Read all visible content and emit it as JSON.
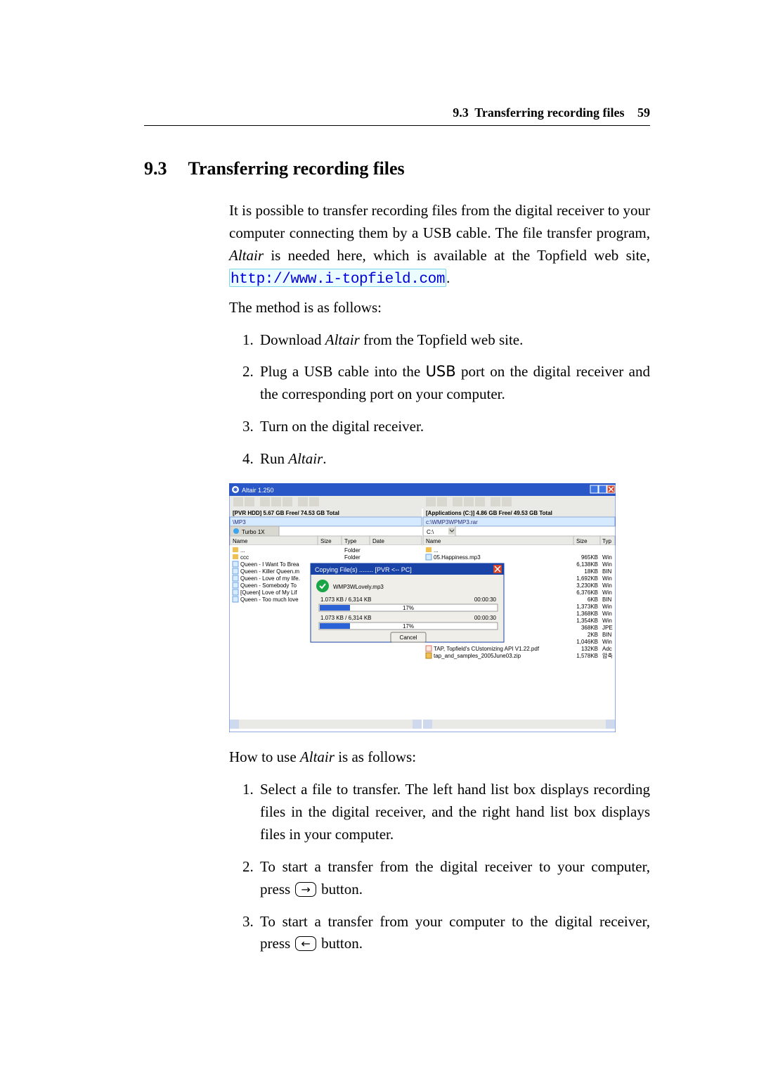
{
  "running_head": {
    "section_num": "9.3",
    "section_title": "Transferring recording files",
    "page_num": "59"
  },
  "heading": {
    "number": "9.3",
    "title": "Transferring recording files"
  },
  "para1_a": "It is possible to transfer recording files from the digital receiver to your computer connecting them by a USB cable. The file transfer program, ",
  "para1_b": " is needed here, which is available at the Topfield web site, ",
  "altair": "Altair",
  "url": "http://www.i-topfield.com",
  "para1_c": ".",
  "method_intro": "The method is as follows:",
  "steps_a": {
    "s1a": "Download ",
    "s1b": " from the Topfield web site.",
    "s2a": "Plug a USB cable into the ",
    "usb": "USB",
    "s2b": " port on the digital receiver and the corresponding port on your computer.",
    "s3": "Turn on the digital receiver.",
    "s4a": "Run ",
    "s4b": "."
  },
  "screenshot": {
    "title": "Altair  1.250",
    "left_stat": "[PVR HDD] 5.67 GB Free/ 74.53 GB Total",
    "right_stat": "[Applications (C:)] 4.86 GB Free/ 49.53 GB Total",
    "left_path": "\\MP3",
    "right_path": "c:\\WMP3WPMP3.rar",
    "turbo_btn": "Turbo  1X",
    "drive_sel": "C:\\",
    "hdr_name": "Name",
    "hdr_size": "Size",
    "hdr_type": "Type",
    "hdr_date": "Date",
    "hdr_typ2": "Typ",
    "left_rows": [
      {
        "name": "...",
        "type": "Folder"
      },
      {
        "name": "ccc",
        "type": "Folder"
      },
      {
        "name": "Queen - I Want To Brea"
      },
      {
        "name": "Queen - Killer Queen.m"
      },
      {
        "name": "Queen - Love of my life."
      },
      {
        "name": "Queen - Somebody To"
      },
      {
        "name": "[Queen] Love of My Lif"
      },
      {
        "name": "Queen - Too much love"
      }
    ],
    "right_rows": [
      {
        "name": "...",
        "size": "",
        "typ": ""
      },
      {
        "name": "05.Happiness.mp3",
        "size": "965KB",
        "typ": "Win"
      },
      {
        "name": "",
        "size": "6,138KB",
        "typ": "Win"
      },
      {
        "name": "",
        "size": "18KB",
        "typ": "BIN"
      },
      {
        "name": "",
        "size": "1,692KB",
        "typ": "Win"
      },
      {
        "name": "",
        "size": "3,230KB",
        "typ": "Win"
      },
      {
        "name": "",
        "size": "6,376KB",
        "typ": "Win"
      },
      {
        "name": "",
        "size": "6KB",
        "typ": "BIN"
      },
      {
        "name": "",
        "size": "1,373KB",
        "typ": "Win"
      },
      {
        "name": "",
        "size": "1,368KB",
        "typ": "Win"
      },
      {
        "name": "",
        "size": "1,354KB",
        "typ": "Win"
      },
      {
        "name": "",
        "size": "368KB",
        "typ": "JPE"
      },
      {
        "name": "",
        "size": "2KB",
        "typ": "BIN"
      },
      {
        "name": "",
        "size": "1,046KB",
        "typ": "Win"
      },
      {
        "name": "TAP, Topfield's CUstomizing API V1.22.pdf",
        "size": "132KB",
        "typ": "Adc"
      },
      {
        "name": "tap_and_samples_2005June03.zip",
        "size": "1,578KB",
        "typ": "압축"
      }
    ],
    "dialog": {
      "title": "Copying File(s) ........ [PVR <-- PC]",
      "file": "WMP3WLovely.mp3",
      "prog": "1.073 KB / 6,314 KB",
      "percent": "17%",
      "eta": "00:00:30",
      "cancel": "Cancel"
    }
  },
  "howto_intro_a": "How to use ",
  "howto_intro_b": " is as follows:",
  "steps_b": {
    "s1": "Select a file to transfer. The left hand list box displays recording files in the digital receiver, and the right hand list box displays files in your computer.",
    "s2a": "To start a transfer from the digital receiver to your computer, press ",
    "s2b": " button.",
    "s3a": "To start a transfer from your computer to the digital receiver, press ",
    "s3b": " button."
  },
  "key_right": "→",
  "key_left": "←"
}
